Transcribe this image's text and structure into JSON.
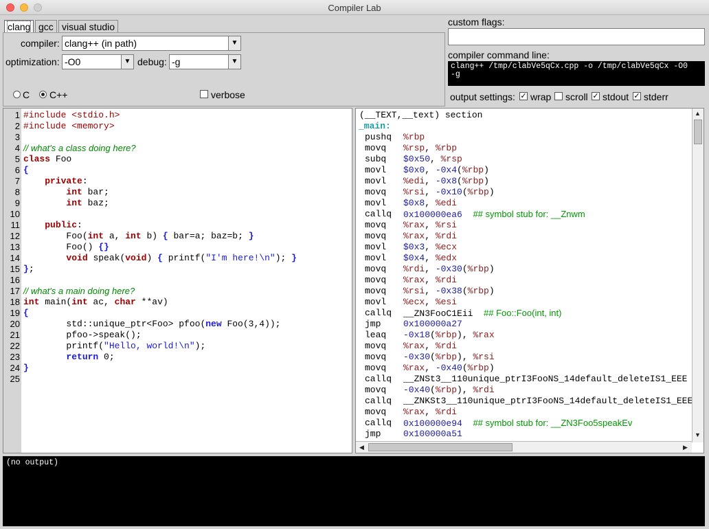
{
  "window": {
    "title": "Compiler Lab"
  },
  "tabs": [
    {
      "label": "clang",
      "active": true
    },
    {
      "label": "gcc",
      "active": false
    },
    {
      "label": "visual studio",
      "active": false
    }
  ],
  "settings": {
    "compiler_label": "compiler:",
    "compiler_value": "clang++ (in path)",
    "optimization_label": "optimization:",
    "optimization_value": "-O0",
    "debug_label": "debug:",
    "debug_value": "-g",
    "lang_c": "C",
    "lang_cpp": "C++",
    "lang_selected": "C++",
    "verbose_label": "verbose",
    "verbose_checked": false
  },
  "custom_flags": {
    "label": "custom flags:",
    "value": ""
  },
  "command_line": {
    "label": "compiler command line:",
    "value": "clang++ /tmp/clabVe5qCx.cpp -o /tmp/clabVe5qCx -O0\n-g"
  },
  "output_settings": {
    "label": "output settings:",
    "wrap": {
      "label": "wrap",
      "checked": true
    },
    "scroll": {
      "label": "scroll",
      "checked": false
    },
    "stdout": {
      "label": "stdout",
      "checked": true
    },
    "stderr": {
      "label": "stderr",
      "checked": true
    }
  },
  "source_lines": [
    "#include <stdio.h>",
    "#include <memory>",
    "",
    "// what's a class doing here?",
    "class Foo",
    "{",
    "    private:",
    "        int bar;",
    "        int baz;",
    "",
    "    public:",
    "        Foo(int a, int b) { bar=a; baz=b; }",
    "        Foo() {}",
    "        void speak(void) { printf(\"I'm here!\\n\"); }",
    "};",
    "",
    "// what's a main doing here?",
    "int main(int ac, char **av)",
    "{",
    "        std::unique_ptr<Foo> pfoo(new Foo(3,4));",
    "        pfoo->speak();",
    "        printf(\"Hello, world!\\n\");",
    "        return 0;",
    "}",
    ""
  ],
  "asm": {
    "header": "(__TEXT,__text) section",
    "label": "_main:",
    "lines": [
      {
        "op": "pushq",
        "args": "%rbp"
      },
      {
        "op": "movq",
        "args": "%rsp, %rbp"
      },
      {
        "op": "subq",
        "args": "$0x50, %rsp"
      },
      {
        "op": "movl",
        "args": "$0x0, -0x4(%rbp)"
      },
      {
        "op": "movl",
        "args": "%edi, -0x8(%rbp)"
      },
      {
        "op": "movq",
        "args": "%rsi, -0x10(%rbp)"
      },
      {
        "op": "movl",
        "args": "$0x8, %edi"
      },
      {
        "op": "callq",
        "args": "0x100000ea6",
        "comment": "## symbol stub for: __Znwm"
      },
      {
        "op": "movq",
        "args": "%rax, %rsi"
      },
      {
        "op": "movq",
        "args": "%rax, %rdi"
      },
      {
        "op": "movl",
        "args": "$0x3, %ecx"
      },
      {
        "op": "movl",
        "args": "$0x4, %edx"
      },
      {
        "op": "movq",
        "args": "%rdi, -0x30(%rbp)"
      },
      {
        "op": "movq",
        "args": "%rax, %rdi"
      },
      {
        "op": "movq",
        "args": "%rsi, -0x38(%rbp)"
      },
      {
        "op": "movl",
        "args": "%ecx, %esi"
      },
      {
        "op": "callq",
        "args": "__ZN3FooC1Eii",
        "comment": "## Foo::Foo(int, int)"
      },
      {
        "op": "jmp",
        "args": "0x100000a27"
      },
      {
        "op": "leaq",
        "args": "-0x18(%rbp), %rax"
      },
      {
        "op": "movq",
        "args": "%rax, %rdi"
      },
      {
        "op": "movq",
        "args": "-0x30(%rbp), %rsi"
      },
      {
        "op": "movq",
        "args": "%rax, -0x40(%rbp)"
      },
      {
        "op": "callq",
        "args": "__ZNSt3__110unique_ptrI3FooNS_14default_deleteIS1_EEE"
      },
      {
        "op": "movq",
        "args": "-0x40(%rbp), %rdi"
      },
      {
        "op": "callq",
        "args": "__ZNKSt3__110unique_ptrI3FooNS_14default_deleteIS1_EEE"
      },
      {
        "op": "movq",
        "args": "%rax, %rdi"
      },
      {
        "op": "callq",
        "args": "0x100000e94",
        "comment": "## symbol stub for: __ZN3Foo5speakEv"
      },
      {
        "op": "jmp",
        "args": "0x100000a51"
      }
    ]
  },
  "output": {
    "text": "(no output)"
  }
}
